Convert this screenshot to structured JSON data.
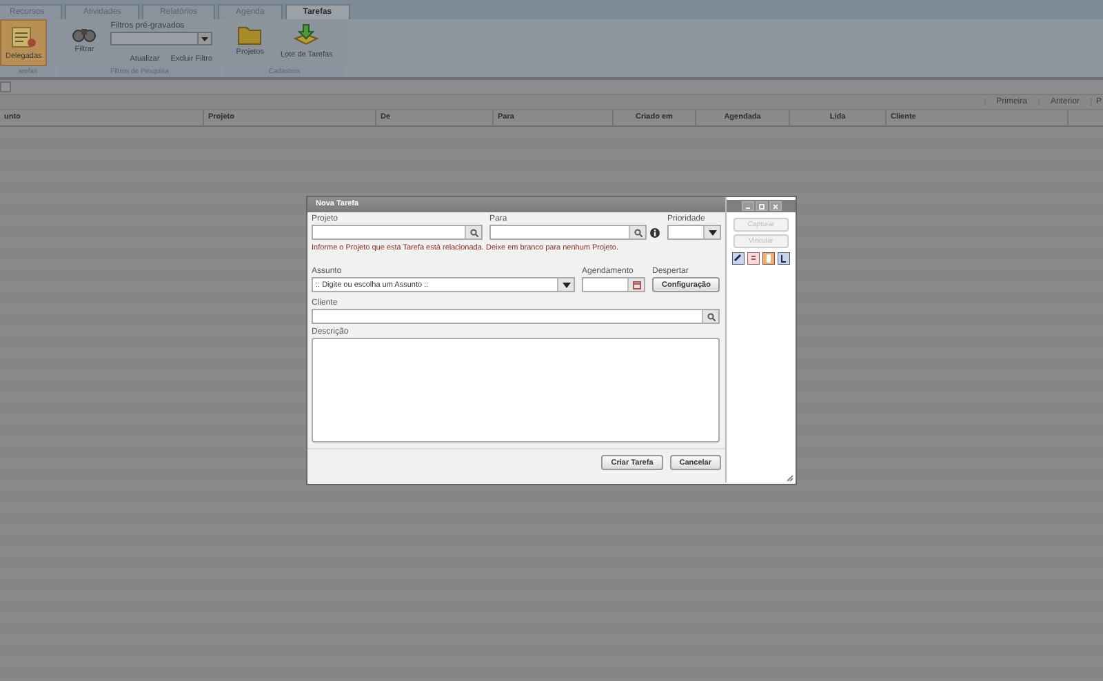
{
  "tabs": [
    {
      "label": "Recursos",
      "selected": false
    },
    {
      "label": "Atividades",
      "selected": false
    },
    {
      "label": "Relatórios",
      "selected": false
    },
    {
      "label": "Agenda",
      "selected": false
    },
    {
      "label": "Tarefas",
      "selected": true
    }
  ],
  "ribbon": {
    "groups": [
      {
        "kind": "buttons",
        "label": "arefas",
        "buttons": [
          {
            "label": "Delegadas",
            "selected": true
          }
        ]
      },
      {
        "kind": "filters",
        "label": "Filtros de Pesquisa",
        "buttons": [
          {
            "label": "Filtrar",
            "selected": false
          }
        ],
        "preset_label": "Filtros pré-gravados",
        "actions": [
          "Atualizar",
          "Excluir Filtro"
        ]
      },
      {
        "kind": "buttons",
        "label": "Cadastros",
        "buttons": [
          {
            "label": "Projetos",
            "selected": false
          },
          {
            "label": "Lote de Tarefas",
            "selected": false
          }
        ]
      }
    ]
  },
  "pager": [
    "Primeira",
    "Anterior",
    "P"
  ],
  "table": {
    "columns": [
      "unto",
      "Projeto",
      "De",
      "Para",
      "Criado em",
      "Agendada",
      "Lida",
      "Cliente"
    ]
  },
  "dialog": {
    "title": "Nova Tarefa",
    "projeto_label": "Projeto",
    "para_label": "Para",
    "prioridade_label": "Prioridade",
    "hint": "Informe o Projeto que esta Tarefa está relacionada. Deixe em branco para nenhum Projeto.",
    "assunto_label": "Assunto",
    "assunto_value": ":: Digite ou escolha um Assunto ::",
    "agendamento_label": "Agendamento",
    "despertar_label": "Despertar",
    "config_button": "Configuração",
    "cliente_label": "Cliente",
    "descricao_label": "Descrição",
    "buttons": [
      "Criar Tarefa",
      "Cancelar"
    ],
    "side_buttons": [
      {
        "label": "Capturar",
        "disabled": true
      },
      {
        "label": "Vincular",
        "disabled": true
      }
    ]
  }
}
